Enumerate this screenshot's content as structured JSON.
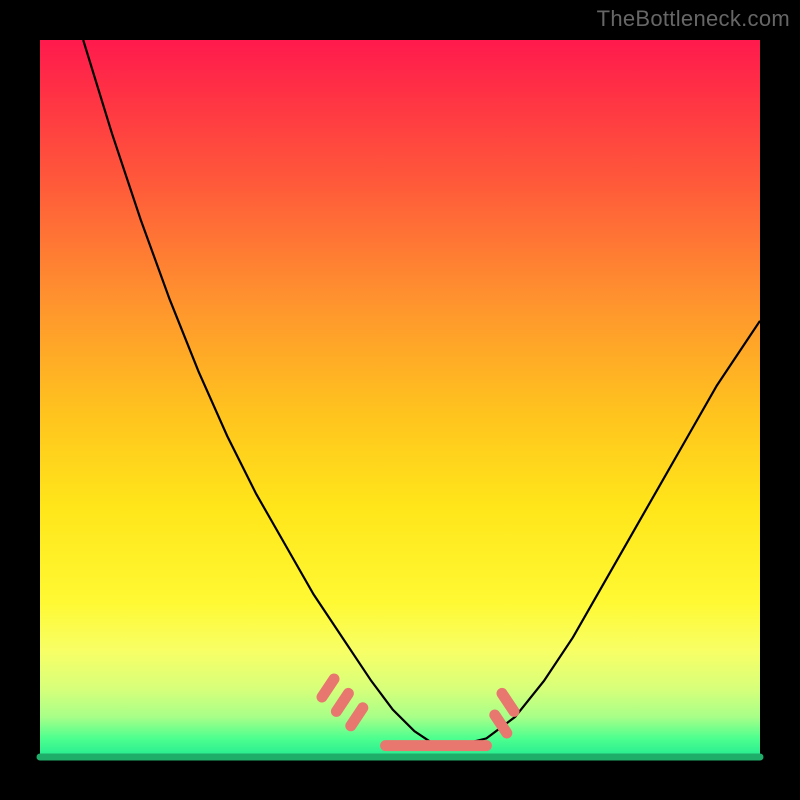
{
  "watermark": "TheBottleneck.com",
  "colors": {
    "frame": "#000000",
    "gradient_top": "#ff1a4d",
    "gradient_bottom": "#1ee890",
    "curve": "#000000",
    "marker": "#e8776f",
    "baseline": "#1fae6a",
    "watermark_text": "#666666"
  },
  "chart_data": {
    "type": "line",
    "title": "",
    "xlabel": "",
    "ylabel": "",
    "xlim": [
      0,
      100
    ],
    "ylim": [
      0,
      100
    ],
    "series": [
      {
        "name": "bottleneck-curve",
        "x": [
          6,
          10,
          14,
          18,
          22,
          26,
          30,
          34,
          38,
          42,
          46,
          49,
          52,
          55,
          58,
          62,
          66,
          70,
          74,
          78,
          82,
          86,
          90,
          94,
          98,
          100
        ],
        "y": [
          100,
          87,
          75,
          64,
          54,
          45,
          37,
          30,
          23,
          17,
          11,
          7,
          4,
          2,
          2,
          3,
          6,
          11,
          17,
          24,
          31,
          38,
          45,
          52,
          58,
          61
        ]
      }
    ],
    "markers": {
      "name": "highlight-dots",
      "x": [
        40,
        42,
        44,
        48,
        50,
        52,
        54,
        56,
        58,
        60,
        62,
        64,
        65
      ],
      "y": [
        10,
        8,
        6,
        3,
        2,
        2,
        2,
        2,
        2,
        2,
        3,
        5,
        8
      ]
    },
    "baseline_y": 0
  }
}
